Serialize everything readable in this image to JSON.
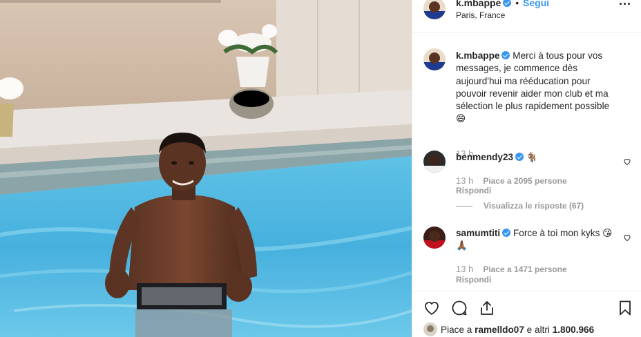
{
  "post": {
    "username": "k.mbappe",
    "separator": "•",
    "follow_label": "Segui",
    "location": "Paris, France",
    "caption": "Merci à tous pour vos messages, je commence dès aujourd'hui ma rééducation pour pouvoir revenir aider mon club et ma sélection le plus rapidement possible",
    "caption_emoji": "😄",
    "caption_time": "13 h"
  },
  "comments": [
    {
      "username": "benmendy23",
      "text": "🐐",
      "time": "13 h",
      "likes": "Piace a 2095 persone",
      "reply_label": "Rispondi",
      "view_replies": "Visualizza le risposte (67)"
    },
    {
      "username": "samumtiti",
      "text": "Force à toi mon kyks 😘🙏🏾",
      "time": "13 h",
      "likes": "Piace a 1471 persone",
      "reply_label": "Rispondi"
    }
  ],
  "likes_summary": {
    "prefix": "Piace a ",
    "user": "ramelldo07",
    "suffix": " e altri ",
    "count": "1.800.966"
  },
  "icons": {
    "more": "more-options-icon",
    "like": "heart-icon",
    "comment": "comment-bubble-icon",
    "share": "share-icon",
    "save": "bookmark-icon"
  },
  "colors": {
    "accent": "#3897f0",
    "text": "#262626",
    "muted": "#999999",
    "border": "#efefef"
  }
}
